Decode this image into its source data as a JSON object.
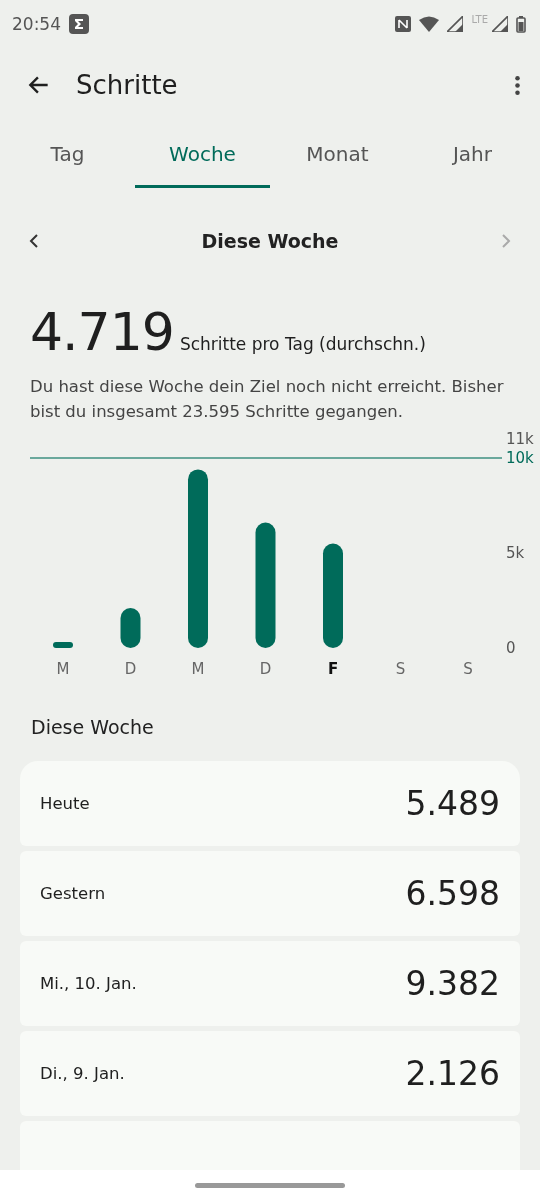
{
  "status_bar": {
    "time": "20:54",
    "network": "LTE"
  },
  "app_bar": {
    "title": "Schritte"
  },
  "tabs": [
    {
      "label": "Tag",
      "selected": false
    },
    {
      "label": "Woche",
      "selected": true
    },
    {
      "label": "Monat",
      "selected": false
    },
    {
      "label": "Jahr",
      "selected": false
    }
  ],
  "period": {
    "label": "Diese Woche",
    "next_disabled": true
  },
  "summary": {
    "value": "4.719",
    "unit": "Schritte pro Tag (durchschn.)",
    "text": "Du hast diese Woche dein Ziel noch nicht erreicht. Bisher bist du insgesamt 23.595 Schritte gegangen."
  },
  "chart": {
    "chart_data": {
      "type": "bar",
      "categories": [
        "M",
        "D",
        "M",
        "D",
        "F",
        "S",
        "S"
      ],
      "values": [
        0,
        2100,
        9400,
        6600,
        5500,
        null,
        null
      ],
      "ylim": [
        0,
        11000
      ],
      "yticks": [
        {
          "value": 0,
          "label": "0"
        },
        {
          "value": 5000,
          "label": "5k"
        },
        {
          "value": 10000,
          "label": "10k"
        },
        {
          "value": 11000,
          "label": "11k"
        }
      ],
      "ref_lines": [
        {
          "axis": "y",
          "value": 10000
        }
      ]
    },
    "day_marks": [
      {
        "selected": false
      },
      {
        "selected": false
      },
      {
        "selected": false
      },
      {
        "selected": false
      },
      {
        "selected": true
      },
      {
        "selected": false
      },
      {
        "selected": false
      }
    ]
  },
  "list": {
    "title": "Diese Woche",
    "rows": [
      {
        "label": "Heute",
        "value": "5.489"
      },
      {
        "label": "Gestern",
        "value": "6.598"
      },
      {
        "label": "Mi., 10. Jan.",
        "value": "9.382"
      },
      {
        "label": "Di., 9. Jan.",
        "value": "2.126"
      }
    ]
  }
}
